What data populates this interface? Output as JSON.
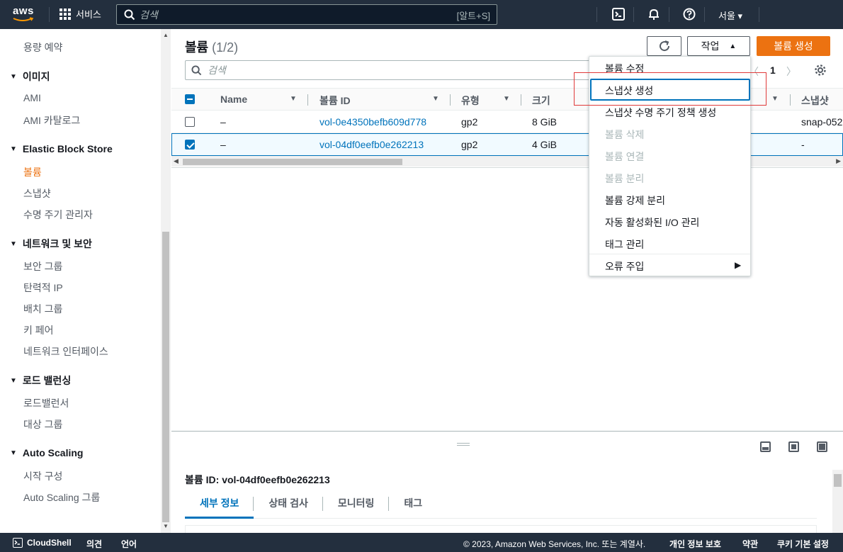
{
  "topnav": {
    "logo": "aws",
    "services": "서비스",
    "search_placeholder": "검색",
    "search_shortcut": "[알트+S]",
    "region": "서울 ▾"
  },
  "sidebar": {
    "items": [
      {
        "type": "link",
        "label": "용량 예약"
      },
      {
        "type": "head",
        "label": "이미지"
      },
      {
        "type": "link",
        "label": "AMI"
      },
      {
        "type": "link",
        "label": "AMI 카탈로그"
      },
      {
        "type": "head",
        "label": "Elastic Block Store"
      },
      {
        "type": "link",
        "label": "볼륨",
        "active": true
      },
      {
        "type": "link",
        "label": "스냅샷"
      },
      {
        "type": "link",
        "label": "수명 주기 관리자"
      },
      {
        "type": "head",
        "label": "네트워크 및 보안"
      },
      {
        "type": "link",
        "label": "보안 그룹"
      },
      {
        "type": "link",
        "label": "탄력적 IP"
      },
      {
        "type": "link",
        "label": "배치 그룹"
      },
      {
        "type": "link",
        "label": "키 페어"
      },
      {
        "type": "link",
        "label": "네트워크 인터페이스"
      },
      {
        "type": "head",
        "label": "로드 밸런싱"
      },
      {
        "type": "link",
        "label": "로드밸런서"
      },
      {
        "type": "link",
        "label": "대상 그룹"
      },
      {
        "type": "head",
        "label": "Auto Scaling"
      },
      {
        "type": "link",
        "label": "시작 구성"
      },
      {
        "type": "link",
        "label": "Auto Scaling 그룹"
      }
    ]
  },
  "main": {
    "title": "볼륨",
    "count": "(1/2)",
    "actions_label": "작업",
    "create_label": "볼륨 생성",
    "search_placeholder": "검색",
    "page_number": "1"
  },
  "table": {
    "columns": [
      "Name",
      "볼륨 ID",
      "유형",
      "크기",
      "스냅샷"
    ],
    "rows": [
      {
        "name": "–",
        "volume_id": "vol-0e4350befb609d778",
        "type": "gp2",
        "size": "8 GiB",
        "snapshot": "snap-052",
        "selected": false
      },
      {
        "name": "–",
        "volume_id": "vol-04df0eefb0e262213",
        "type": "gp2",
        "size": "4 GiB",
        "snapshot": "-",
        "selected": true
      }
    ]
  },
  "actions_menu": {
    "items": [
      {
        "label": "볼륨 수정",
        "disabled": false
      },
      {
        "label": "스냅샷 생성",
        "disabled": false,
        "highlighted": true
      },
      {
        "label": "스냅샷 수명 주기 정책 생성",
        "disabled": false
      },
      {
        "label": "볼륨 삭제",
        "disabled": true
      },
      {
        "label": "볼륨 연결",
        "disabled": true
      },
      {
        "label": "볼륨 분리",
        "disabled": true
      },
      {
        "label": "볼륨 강제 분리",
        "disabled": false
      },
      {
        "label": "자동 활성화된 I/O 관리",
        "disabled": false
      },
      {
        "label": "태그 관리",
        "disabled": false
      },
      {
        "label": "오류 주입",
        "disabled": false,
        "submenu": true
      }
    ]
  },
  "details": {
    "volume_id_label": "볼륨 ID: vol-04df0eefb0e262213",
    "tabs": [
      "세부 정보",
      "상태 검사",
      "모니터링",
      "태그"
    ],
    "active_tab": "세부 정보"
  },
  "footer": {
    "cloudshell": "CloudShell",
    "feedback": "의견",
    "language": "언어",
    "copyright": "© 2023, Amazon Web Services, Inc. 또는 계열사.",
    "privacy": "개인 정보 보호",
    "terms": "약관",
    "cookies": "쿠키 기본 설정"
  },
  "colors": {
    "nav_bg": "#232f3e",
    "accent_orange": "#ec7211",
    "link_blue": "#0073bb",
    "annotation_red": "#e03a3a"
  }
}
